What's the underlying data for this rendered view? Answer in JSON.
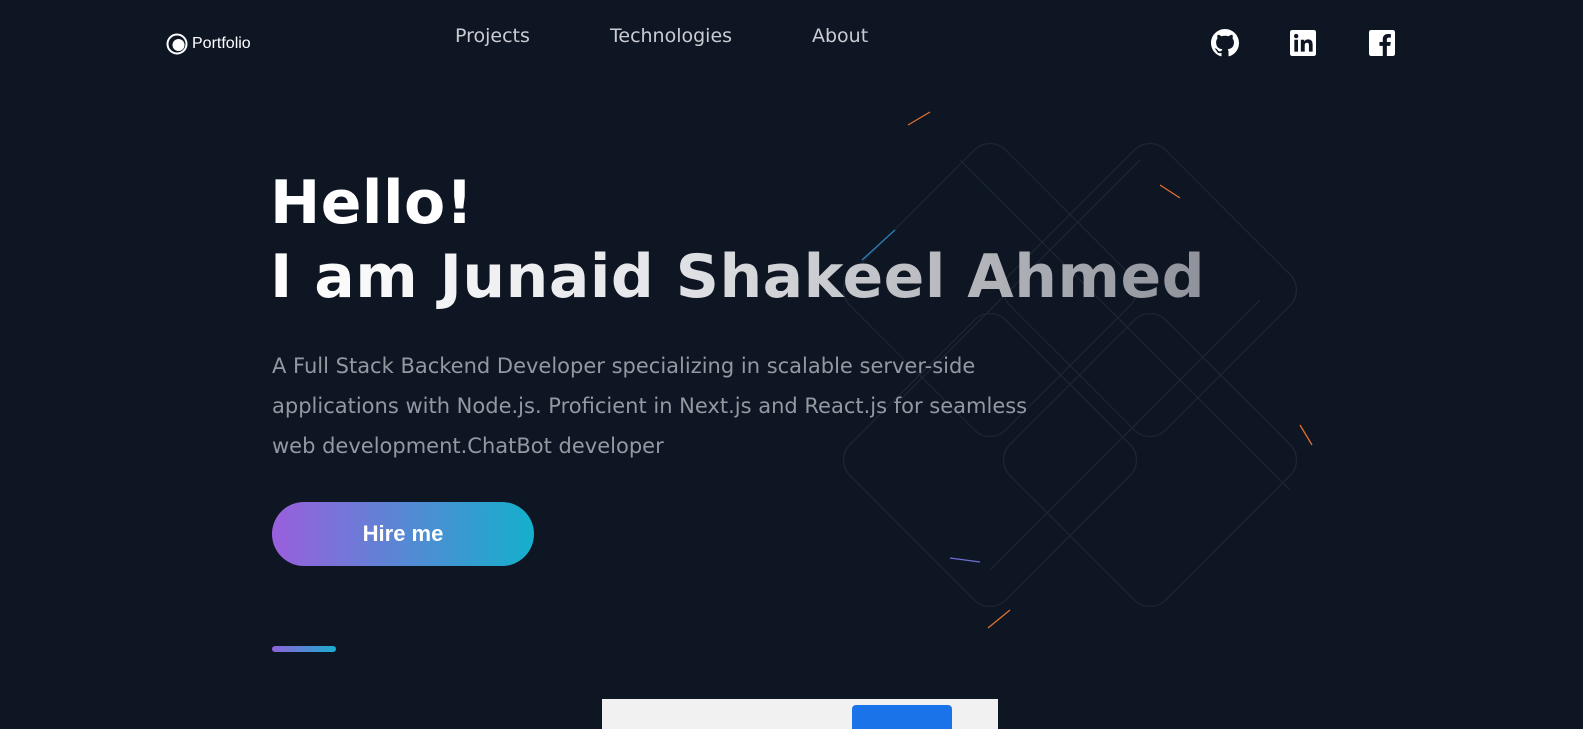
{
  "nav": {
    "logo_text": "Portfolio",
    "links": [
      "Projects",
      "Technologies",
      "About"
    ],
    "social": [
      "github-icon",
      "linkedin-icon",
      "facebook-icon"
    ]
  },
  "hero": {
    "greeting": "Hello!",
    "name_line": "I am Junaid Shakeel Ahmed",
    "description": "A Full Stack Backend Developer specializing in scalable server-side applications with Node.js. Proficient in Next.js and React.js for seamless web development.ChatBot developer",
    "cta_label": "Hire me"
  },
  "colors": {
    "background": "#0f1623",
    "gradient_start": "#9a5fdc",
    "gradient_end": "#14b0cc"
  }
}
